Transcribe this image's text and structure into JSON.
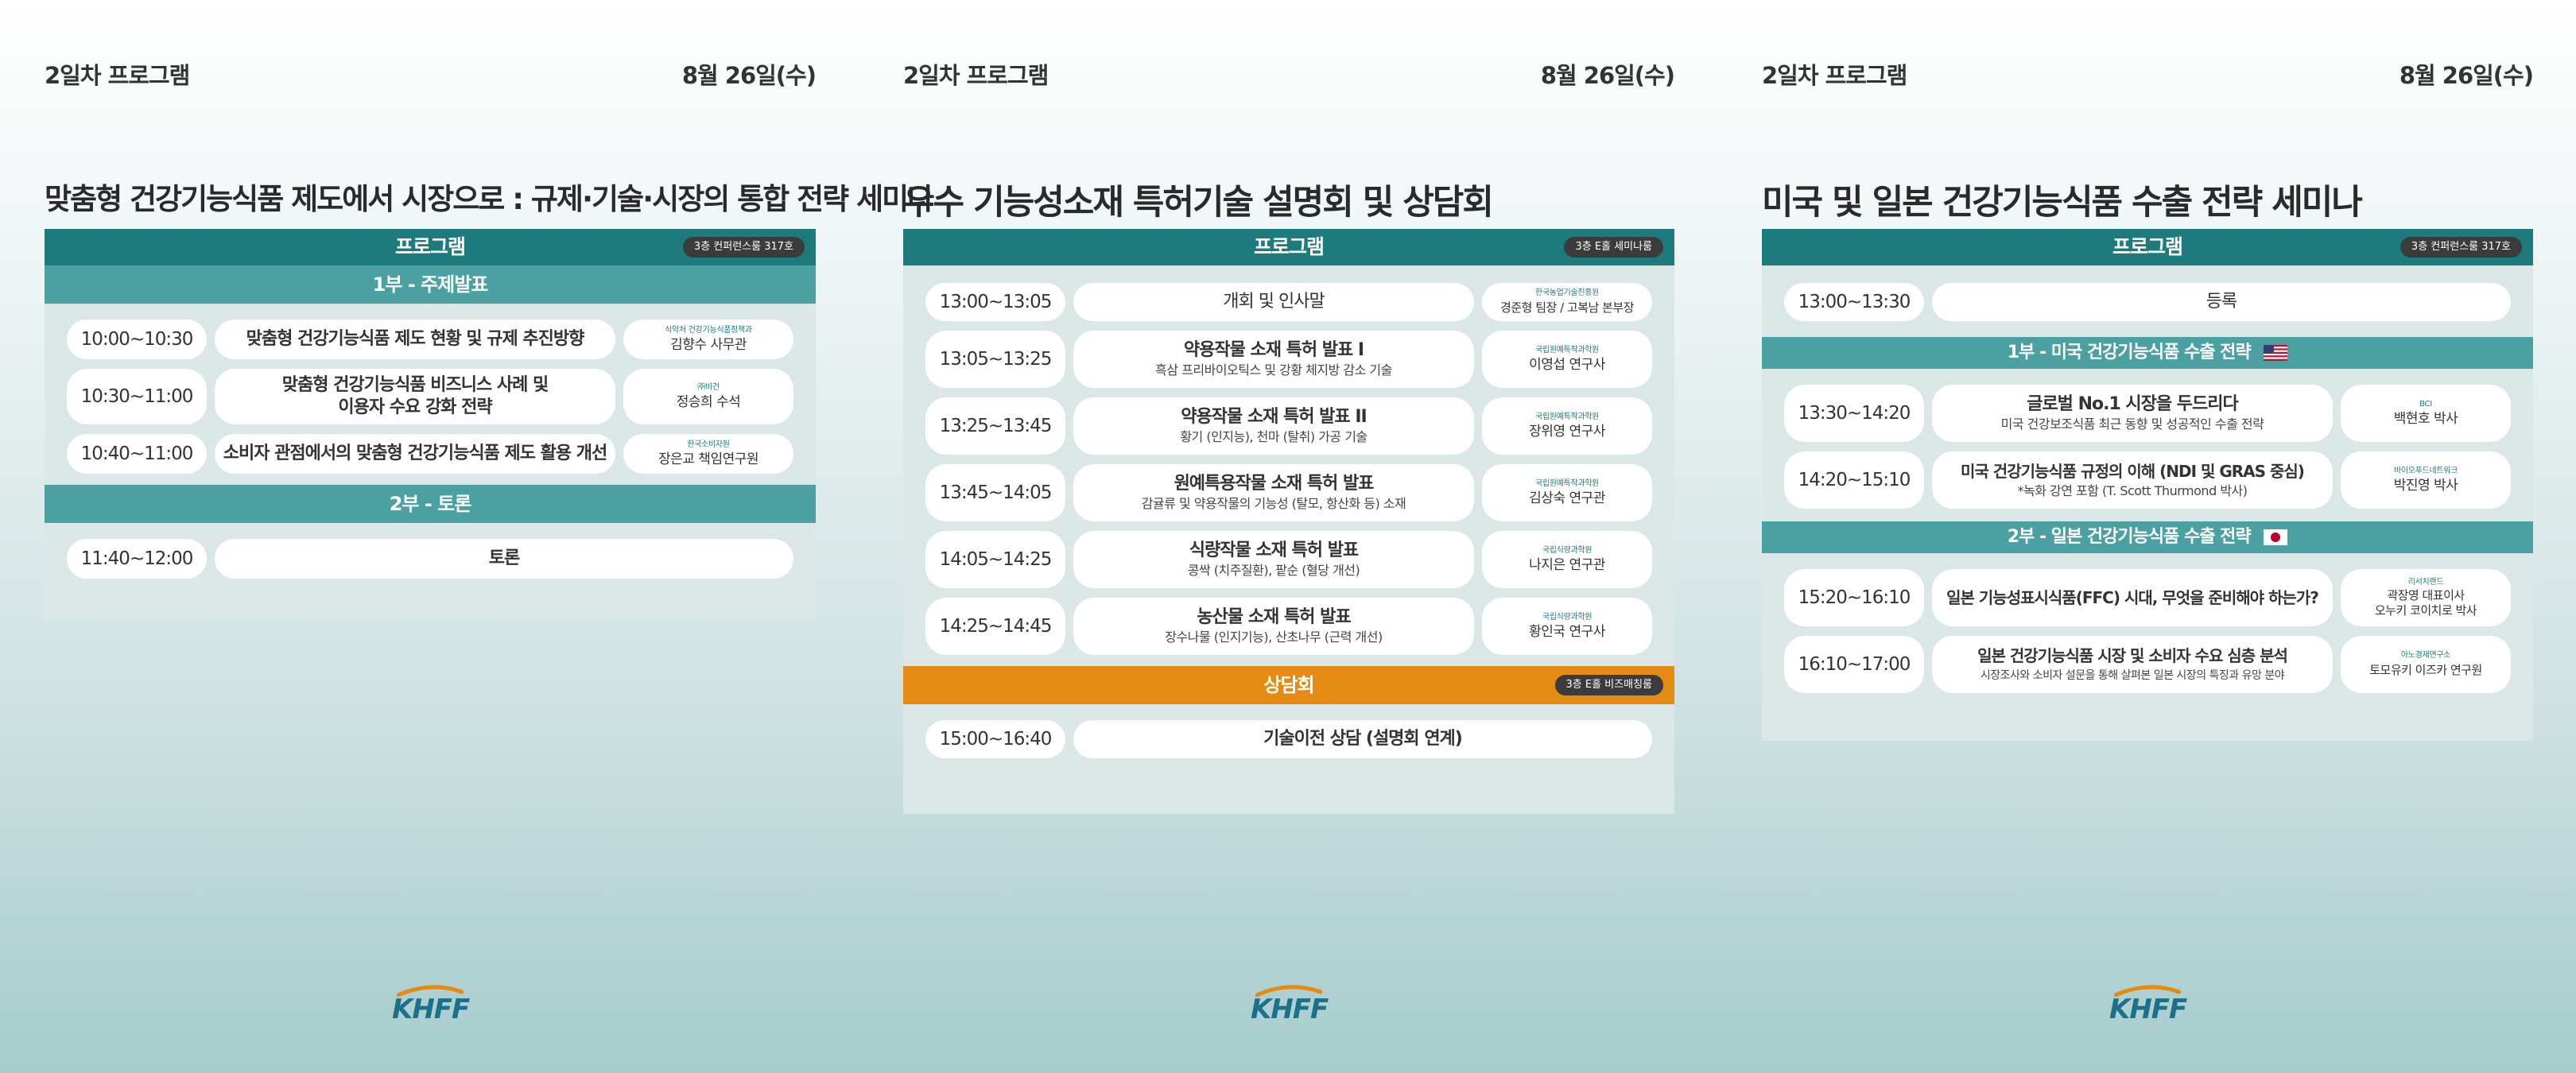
{
  "logo_text": "KHFF",
  "panels": [
    {
      "header_left": "2일차 프로그램",
      "header_right": "8월 26일(수)",
      "title": "맞춤형 건강기능식품 제도에서 시장으로 : 규제·기술·시장의 통합 전략 세미나",
      "program_label": "프로그램",
      "room": "3층 컨퍼런스룸 317호",
      "sections": [
        {
          "label": "1부 - 주제발표",
          "rows": [
            {
              "time": "10:00~10:30",
              "topic": "맞춤형 건강기능식품 제도 현황 및 규제 추진방향",
              "org": "식약처 건강기능식품정책과",
              "name": "김향수 사무관"
            },
            {
              "time": "10:30~11:00",
              "topic": "맞춤형 건강기능식품 비즈니스 사례 및",
              "topic2": "이용자 수요 강화 전략",
              "org": "㈜비건",
              "name": "정승희 수석"
            },
            {
              "time": "10:40~11:00",
              "topic": "소비자 관점에서의 맞춤형 건강기능식품 제도 활용 개선",
              "org": "한국소비자원",
              "name": "장은교 책임연구원"
            }
          ]
        },
        {
          "label": "2부 - 토론",
          "rows": [
            {
              "time": "11:40~12:00",
              "topic": "토론"
            }
          ]
        }
      ]
    },
    {
      "header_left": "2일차 프로그램",
      "header_right": "8월 26일(수)",
      "title": "우수 기능성소재 특허기술 설명회 및 상담회",
      "program_label": "프로그램",
      "room": "3층 E홀 세미나룸",
      "rows": [
        {
          "time": "13:00~13:05",
          "topic": "개회 및 인사말",
          "org": "한국농업기술진흥원",
          "name": "경준형 팀장 / 고복남 본부장"
        },
        {
          "time": "13:05~13:25",
          "topic": "약용작물 소재 특허 발표 I",
          "topic2": "흑삼 프리바이오틱스 및 강황 체지방 감소 기술",
          "org": "국립원예특작과학원",
          "name": "이영섭 연구사"
        },
        {
          "time": "13:25~13:45",
          "topic": "약용작물 소재 특허 발표 II",
          "topic2": "황기 (인지능), 천마 (탈취) 가공 기술",
          "org": "국립원예특작과학원",
          "name": "장위영 연구사"
        },
        {
          "time": "13:45~14:05",
          "topic": "원예특용작물 소재 특허 발표",
          "topic2": "감귤류 및 약용작물의 기능성 (탈모, 항산화 등) 소재",
          "org": "국립원예특작과학원",
          "name": "김상숙 연구관"
        },
        {
          "time": "14:05~14:25",
          "topic": "식량작물 소재 특허 발표",
          "topic2": "콩싹 (치주질환), 팥순 (혈당 개선)",
          "org": "국립식량과학원",
          "name": "나지은 연구관"
        },
        {
          "time": "14:25~14:45",
          "topic": "농산물 소재 특허 발표",
          "topic2": "장수나물 (인지기능), 산초나무 (근력 개선)",
          "org": "국립식량과학원",
          "name": "황인국 연구사"
        }
      ],
      "consult_label": "상담회",
      "consult_room": "3층 E홀 비즈매칭룸",
      "consult_rows": [
        {
          "time": "15:00~16:40",
          "topic": "기술이전 상담 (설명회 연계)"
        }
      ]
    },
    {
      "header_left": "2일차 프로그램",
      "header_right": "8월 26일(수)",
      "title": "미국 및 일본 건강기능식품 수출 전략 세미나",
      "program_label": "프로그램",
      "room": "3층 컨퍼런스룸 317호",
      "pre_rows": [
        {
          "time": "13:00~13:30",
          "topic": "등록"
        }
      ],
      "sections": [
        {
          "label": "1부 - 미국 건강기능식품 수출 전략",
          "flag": "us-flag-icon",
          "rows": [
            {
              "time": "13:30~14:20",
              "topic": "글로벌 No.1 시장을 두드리다",
              "topic2": "미국 건강보조식품 최근 동향 및 성공적인 수출 전략",
              "org": "BCI",
              "name": "백현호 박사"
            },
            {
              "time": "14:20~15:10",
              "topic": "미국 건강기능식품 규정의 이해 (NDI 및 GRAS 중심)",
              "topic2": "*녹화 강연 포함 (T. Scott Thurmond 박사)",
              "org": "바이오푸드네트워크",
              "name": "박진영 박사"
            }
          ]
        },
        {
          "label": "2부 - 일본 건강기능식품 수출 전략",
          "flag": "jp-flag-icon",
          "rows": [
            {
              "time": "15:20~16:10",
              "topic": "일본 기능성표시식품(FFC) 시대, 무엇을 준비해야 하는가?",
              "org": "리서치랜드",
              "name": "곽장영 대표이사",
              "name2": "오누키 코이치로 박사"
            },
            {
              "time": "16:10~17:00",
              "topic": "일본 건강기능식품 시장 및 소비자 수요 심층 분석",
              "topic2": "시장조사와 소비자 설문을 통해 살펴본 일본 시장의 특징과 유망 분야",
              "org": "아노경제연구소",
              "name": "토모유키 이즈카 연구원"
            }
          ]
        }
      ]
    }
  ],
  "colors": {
    "teal": "#1d7b7e",
    "teal_light": "#4ba0a2",
    "orange": "#e58a12",
    "card_bg": "#dbe7e7"
  }
}
